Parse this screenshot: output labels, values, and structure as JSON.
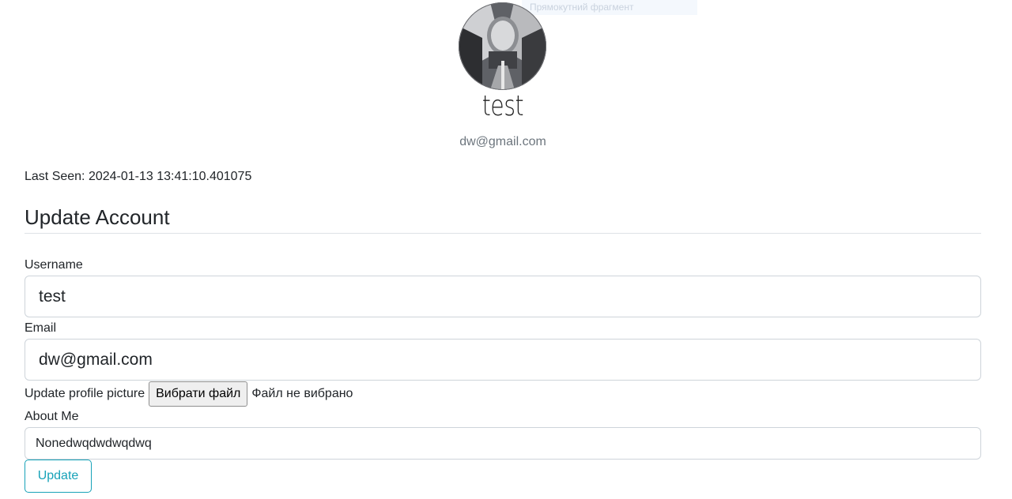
{
  "screen_hint": "Прямокутний фрагмент",
  "profile": {
    "avatar_icon": "user-avatar-photo",
    "username": "test",
    "email": "dw@gmail.com",
    "last_seen": "Last Seen: 2024-01-13 13:41:10.401075"
  },
  "form": {
    "legend": "Update Account",
    "username_label": "Username",
    "username_value": "test",
    "email_label": "Email",
    "email_value": "dw@gmail.com",
    "picture_label": "Update profile picture",
    "file_button_label": "Вибрати файл",
    "file_status": "Файл не вибрано",
    "about_label": "About Me",
    "about_value": "Nonedwqdwdwqdwq",
    "submit_label": "Update"
  },
  "colors": {
    "accent": "#17a2b8",
    "muted_text": "#6c757d",
    "border": "#ced4da"
  }
}
